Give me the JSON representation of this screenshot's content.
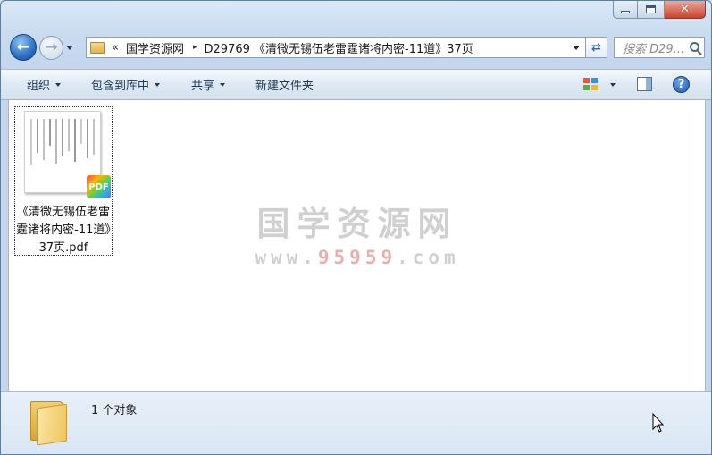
{
  "window": {
    "caption_buttons": {
      "minimize": "minimize",
      "maximize": "maximize",
      "close": "✕"
    }
  },
  "nav": {
    "back_icon": "back-arrow-icon",
    "forward_icon": "forward-arrow-icon"
  },
  "address": {
    "overflow": "«",
    "segments": [
      "国学资源网",
      "D29769 《清微无锡伍老雷霆诸将内密-11道》37页"
    ],
    "separator": "▸"
  },
  "search": {
    "placeholder": "搜索 D29..."
  },
  "toolbar": {
    "organize": "组织",
    "include_library": "包含到库中",
    "share": "共享",
    "new_folder": "新建文件夹"
  },
  "files": [
    {
      "name": "《清微无锡伍老雷霆诸将内密-11道》37页.pdf",
      "badge": "PDF"
    }
  ],
  "watermark": {
    "title": "国学资源网",
    "url_prefix": "www.",
    "url_highlight": "95959",
    "url_suffix": ".com"
  },
  "details": {
    "status": "1 个对象"
  },
  "colors": {
    "accent": "#1e395b",
    "window_frame": "#c3d6ec",
    "close": "#c8432b"
  }
}
